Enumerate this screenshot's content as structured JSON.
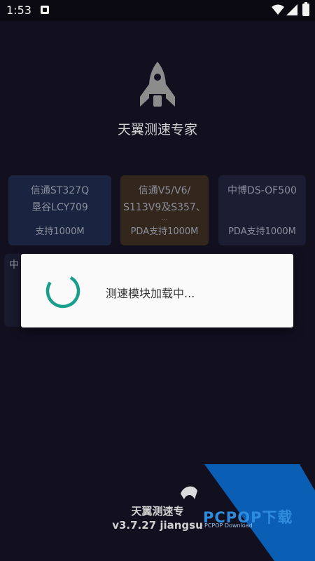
{
  "status_bar": {
    "time": "1:53",
    "icons": [
      "notification-icon",
      "wifi-icon",
      "cellular-signal-icon",
      "battery-icon"
    ]
  },
  "app": {
    "icon": "rocket-icon",
    "title": "天翼测速专家"
  },
  "cards": [
    {
      "lines": [
        "信通ST327Q",
        "垦谷LCY709"
      ],
      "support": "支持1000M",
      "color": "#1a2440"
    },
    {
      "lines": [
        "信通V5/V6/",
        "S113V9及S357、",
        "..."
      ],
      "support": "PDA支持1000M",
      "color": "#33261d"
    },
    {
      "lines": [
        "中博DS-OF500"
      ],
      "support": "PDA支持1000M",
      "color": "#1c1c33"
    },
    {
      "lines": [
        "中"
      ],
      "support": "",
      "color": "#1a1a2e"
    }
  ],
  "dialog": {
    "message": "测速模块加载中...",
    "spinner_color": "#1a9e8c"
  },
  "footer": {
    "app_name": "天翼测速专",
    "version": "v3.7.27 jiangsu"
  },
  "watermark": {
    "brand": "PCPOP下载",
    "sub": "PCPOP Download",
    "color": "#0a5fb5"
  }
}
